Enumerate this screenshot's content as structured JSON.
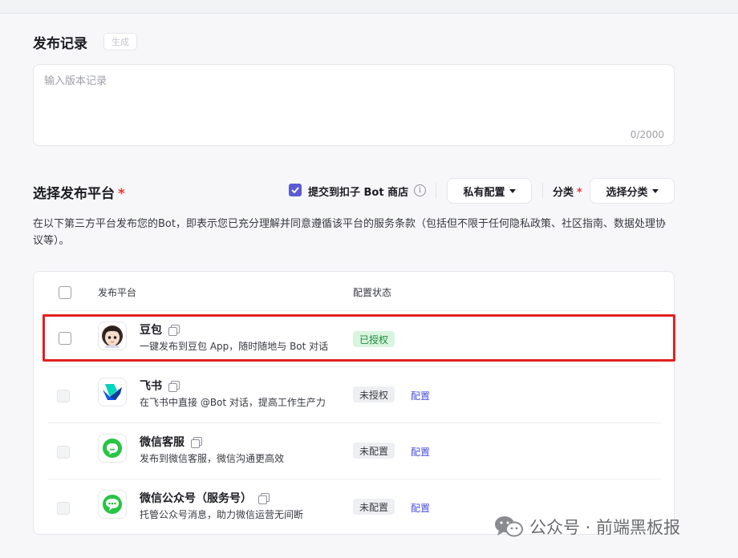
{
  "release_record": {
    "title": "发布记录",
    "generate_label": "生成",
    "placeholder": "输入版本记录",
    "char_count": "0/2000"
  },
  "platform_select": {
    "title": "选择发布平台",
    "required_mark": "*",
    "submit_store_label": "提交到扣子 Bot 商店",
    "submit_store_checked": true,
    "private_config_label": "私有配置",
    "category_label": "分类",
    "category_required": "*",
    "choose_category_label": "选择分类",
    "description": "在以下第三方平台发布您的Bot，即表示您已充分理解并同意遵循该平台的服务条款（包括但不限于任何隐私政策、社区指南、数据处理协议等）。"
  },
  "table": {
    "headers": {
      "platform": "发布平台",
      "status": "配置状态"
    },
    "rows": [
      {
        "name": "豆包",
        "desc": "一键发布到豆包 App，随时随地与 Bot 对话",
        "status": "已授权",
        "status_type": "ok",
        "action": "",
        "icon": "doubao-avatar-icon",
        "selectable": true
      },
      {
        "name": "飞书",
        "desc": "在飞书中直接 @Bot 对话，提高工作生产力",
        "status": "未授权",
        "status_type": "no",
        "action": "配置",
        "icon": "feishu-logo-icon",
        "selectable": false
      },
      {
        "name": "微信客服",
        "desc": "发布到微信客服，微信沟通更高效",
        "status": "未配置",
        "status_type": "no",
        "action": "配置",
        "icon": "wechat-service-icon",
        "selectable": false
      },
      {
        "name": "微信公众号（服务号）",
        "desc": "托管公众号消息，助力微信运营无间断",
        "status": "未配置",
        "status_type": "no",
        "action": "配置",
        "icon": "wechat-official-icon",
        "selectable": false
      }
    ]
  },
  "watermark": {
    "text": "公众号 · 前端黑板报"
  },
  "colors": {
    "accent": "#5b5bd6",
    "link": "#4a4ee0",
    "ok_badge_bg": "#d9f5df",
    "ok_badge_text": "#1f8a3b",
    "highlight": "#e21f1f",
    "wechat_green": "#28c445"
  }
}
